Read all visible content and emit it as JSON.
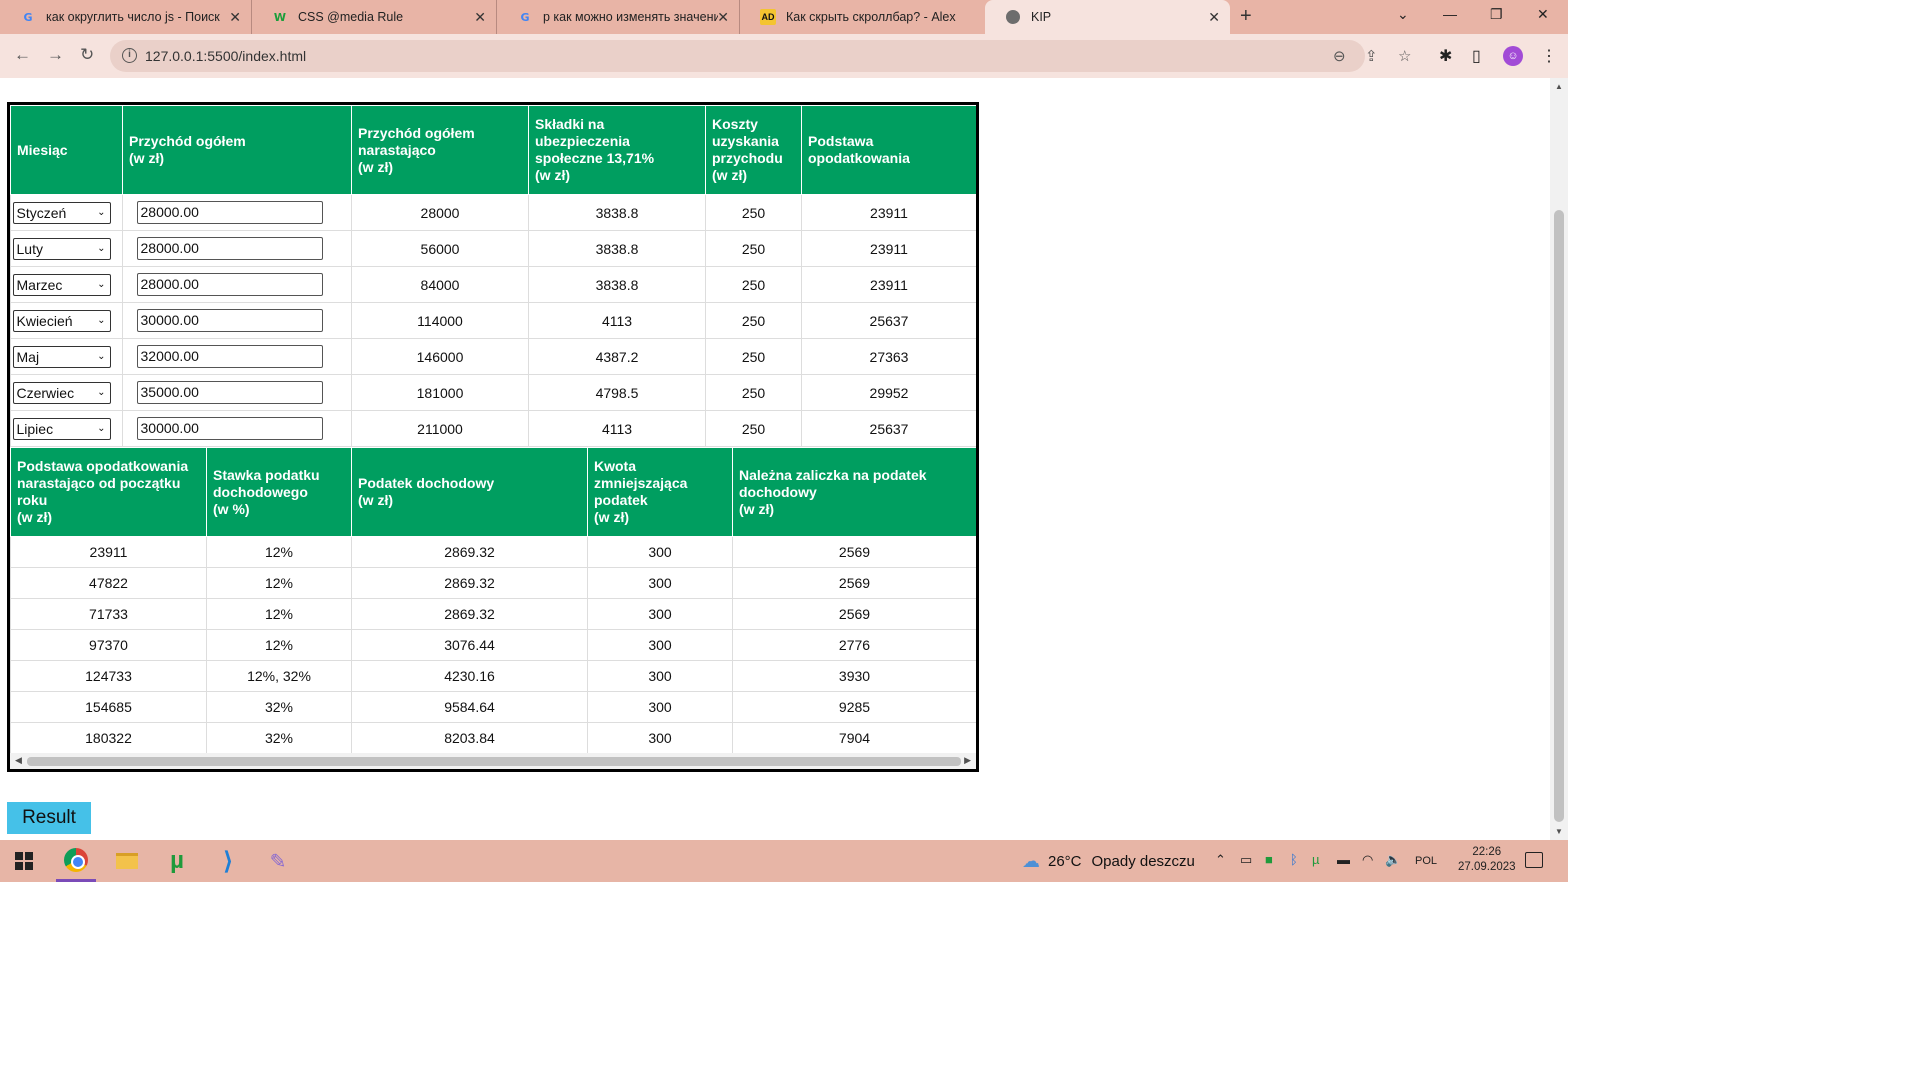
{
  "browser": {
    "tabs": [
      {
        "title": "как округлить число js - Поиск",
        "icon": "google-icon"
      },
      {
        "title": "CSS @media Rule",
        "icon": "w3schools-icon"
      },
      {
        "title": "р как можно изменять значени",
        "icon": "google-icon"
      },
      {
        "title": "Как скрыть скроллбар? - Alexd",
        "icon": "ad-icon"
      },
      {
        "title": "KIP",
        "icon": "globe-icon"
      }
    ],
    "url": "127.0.0.1:5500/index.html"
  },
  "table1": {
    "headers": [
      "Miesiąc",
      "Przychód ogółem\n(w zł)",
      "Przychód ogółem narastająco\n(w zł)",
      "Składki na ubezpieczenia społeczne 13,71%\n(w zł)",
      "Koszty uzyskania przychodu\n(w zł)",
      "Podstawa opodatkowania"
    ],
    "rows": [
      {
        "month": "Styczeń",
        "income": "28000.00",
        "cumulative": "28000",
        "contrib": "3838.8",
        "costs": "250",
        "base": "23911"
      },
      {
        "month": "Luty",
        "income": "28000.00",
        "cumulative": "56000",
        "contrib": "3838.8",
        "costs": "250",
        "base": "23911"
      },
      {
        "month": "Marzec",
        "income": "28000.00",
        "cumulative": "84000",
        "contrib": "3838.8",
        "costs": "250",
        "base": "23911"
      },
      {
        "month": "Kwiecień",
        "income": "30000.00",
        "cumulative": "114000",
        "contrib": "4113",
        "costs": "250",
        "base": "25637"
      },
      {
        "month": "Maj",
        "income": "32000.00",
        "cumulative": "146000",
        "contrib": "4387.2",
        "costs": "250",
        "base": "27363"
      },
      {
        "month": "Czerwiec",
        "income": "35000.00",
        "cumulative": "181000",
        "contrib": "4798.5",
        "costs": "250",
        "base": "29952"
      },
      {
        "month": "Lipiec",
        "income": "30000.00",
        "cumulative": "211000",
        "contrib": "4113",
        "costs": "250",
        "base": "25637"
      }
    ]
  },
  "table2": {
    "headers": [
      "Podstawa opodatkowania narastająco od początku roku\n(w zł)",
      "Stawka podatku dochodowego\n(w %)",
      "Podatek dochodowy\n(w zł)",
      "Kwota zmniejszająca podatek\n(w zł)",
      "Należna zaliczka na podatek dochodowy\n(w zł)"
    ],
    "rows": [
      {
        "base_cum": "23911",
        "rate": "12%",
        "tax": "2869.32",
        "reduction": "300",
        "advance": "2569"
      },
      {
        "base_cum": "47822",
        "rate": "12%",
        "tax": "2869.32",
        "reduction": "300",
        "advance": "2569"
      },
      {
        "base_cum": "71733",
        "rate": "12%",
        "tax": "2869.32",
        "reduction": "300",
        "advance": "2569"
      },
      {
        "base_cum": "97370",
        "rate": "12%",
        "tax": "3076.44",
        "reduction": "300",
        "advance": "2776"
      },
      {
        "base_cum": "124733",
        "rate": "12%, 32%",
        "tax": "4230.16",
        "reduction": "300",
        "advance": "3930"
      },
      {
        "base_cum": "154685",
        "rate": "32%",
        "tax": "9584.64",
        "reduction": "300",
        "advance": "9285"
      },
      {
        "base_cum": "180322",
        "rate": "32%",
        "tax": "8203.84",
        "reduction": "300",
        "advance": "7904"
      }
    ]
  },
  "result_button": "Result",
  "taskbar": {
    "weather_temp": "26°C",
    "weather_desc": "Opady deszczu",
    "lang": "POL",
    "time": "22:26",
    "date": "27.09.2023"
  },
  "colors": {
    "header_green": "#009e60",
    "button_blue": "#45c1e8"
  }
}
